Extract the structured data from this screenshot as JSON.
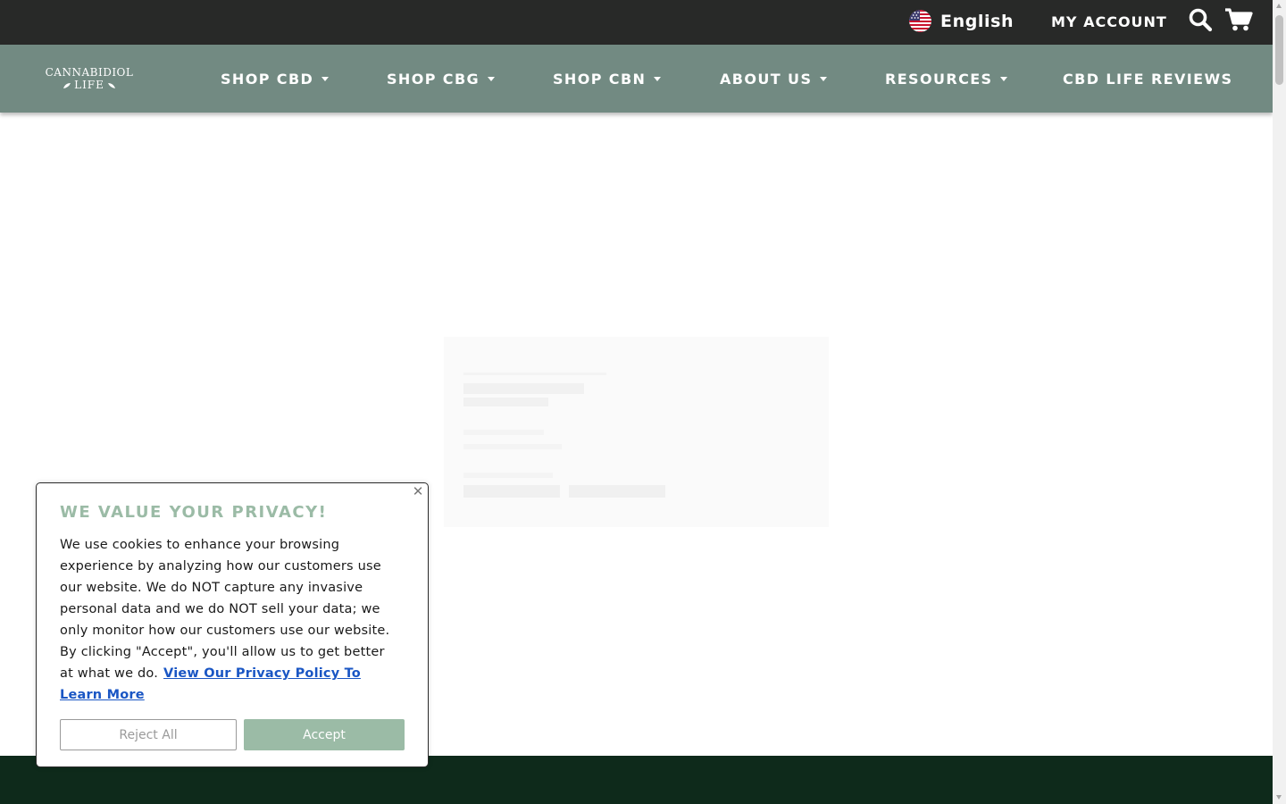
{
  "topbar": {
    "language_label": "English",
    "language_flag_icon": "us-flag-icon",
    "my_account_label": "MY ACCOUNT",
    "search_icon": "search-icon",
    "cart_icon": "cart-icon"
  },
  "navbar": {
    "logo_line1": "CANNABIDIOL",
    "logo_line2": "LIFE",
    "items": [
      {
        "label": "SHOP CBD",
        "has_dropdown": true
      },
      {
        "label": "SHOP CBG",
        "has_dropdown": true
      },
      {
        "label": "SHOP CBN",
        "has_dropdown": true
      },
      {
        "label": "ABOUT US",
        "has_dropdown": true
      },
      {
        "label": "RESOURCES",
        "has_dropdown": true
      },
      {
        "label": "CBD LIFE REVIEWS",
        "has_dropdown": false
      }
    ]
  },
  "cookie_banner": {
    "title": "WE VALUE YOUR PRIVACY!",
    "body": "We use cookies to enhance your browsing experience by analyzing how our customers use our website. We do NOT capture any invasive personal data and we do NOT sell your data; we only monitor how our customers use our website. By clicking \"Accept\", you'll allow us to get better at what we do.",
    "link_text": "View Our Privacy Policy To Learn More",
    "reject_label": "Reject All",
    "accept_label": "Accept",
    "close_icon": "close-icon"
  },
  "colors": {
    "topbar_bg": "#282928",
    "navbar_bg": "#728a82",
    "accent_green": "#9bbba6",
    "footer_bg": "#0e2a1b",
    "link_blue": "#1a56c4"
  }
}
